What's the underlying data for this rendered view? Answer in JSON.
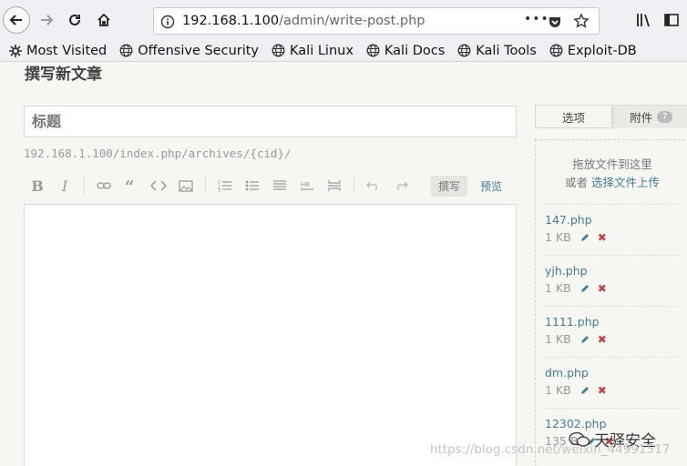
{
  "browser": {
    "url_prefix": "192.168.1.100",
    "url_path": "/admin/write-post.php",
    "more_label": "•••",
    "bookmarks": [
      {
        "label": "Most Visited",
        "icon": "gear-icon"
      },
      {
        "label": "Offensive Security",
        "icon": "globe-icon"
      },
      {
        "label": "Kali Linux",
        "icon": "globe-icon"
      },
      {
        "label": "Kali Docs",
        "icon": "globe-icon"
      },
      {
        "label": "Kali Tools",
        "icon": "globe-icon"
      },
      {
        "label": "Exploit-DB",
        "icon": "globe-icon"
      }
    ]
  },
  "page": {
    "title": "撰写新文章",
    "title_placeholder": "标题",
    "permalink": "192.168.1.100/index.php/archives/{cid}/"
  },
  "editor": {
    "bold": "B",
    "italic": "I",
    "write_mode": "撰写",
    "preview_mode": "预览"
  },
  "sidebar": {
    "tab_options": "选项",
    "tab_attachments": "附件",
    "attachment_count": "7",
    "drop_hint": "拖放文件到这里",
    "or_text": "或者",
    "choose_files": "选择文件上传",
    "files": [
      {
        "name": "147.php",
        "size": "1 KB"
      },
      {
        "name": "yjh.php",
        "size": "1 KB"
      },
      {
        "name": "1111.php",
        "size": "1 KB"
      },
      {
        "name": "dm.php",
        "size": "1 KB"
      },
      {
        "name": "12302.php",
        "size": "135 B"
      }
    ]
  },
  "watermark": {
    "brand": "天驿安全",
    "url": "https://blog.csdn.net/weixin_44991517"
  },
  "colors": {
    "link": "#467b96",
    "delete": "#b94a48",
    "background": "#f6f6f3"
  }
}
